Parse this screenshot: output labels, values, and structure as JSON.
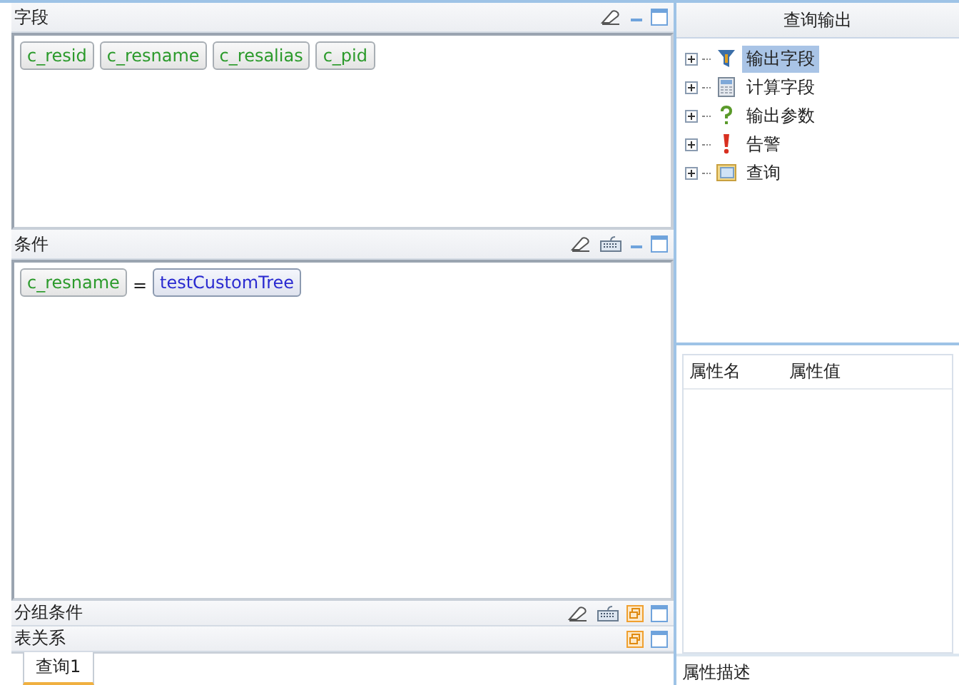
{
  "panels": [
    {
      "title": "字段",
      "keyboard": false,
      "collapsed": false,
      "kind": "fields",
      "chips": [
        "c_resid",
        "c_resname",
        "c_resalias",
        "c_pid"
      ]
    },
    {
      "title": "条件",
      "keyboard": true,
      "collapsed": false,
      "kind": "conditions",
      "conditions": [
        {
          "field": "c_resname",
          "operator": "=",
          "value": "testCustomTree"
        }
      ]
    },
    {
      "title": "分组条件",
      "keyboard": true,
      "collapsed": true
    },
    {
      "title": "表关系",
      "keyboard": false,
      "collapsed": true
    }
  ],
  "tabs": [
    {
      "label": "查询1",
      "selected": true
    }
  ],
  "output": {
    "title": "查询输出",
    "tree": [
      {
        "label": "输出字段",
        "kind": "filter",
        "selected": true,
        "expanded": false
      },
      {
        "label": "计算字段",
        "kind": "calc",
        "selected": false,
        "expanded": false
      },
      {
        "label": "输出参数",
        "kind": "question",
        "selected": false,
        "expanded": false
      },
      {
        "label": "告警",
        "kind": "alert",
        "selected": false,
        "expanded": false
      },
      {
        "label": "查询",
        "kind": "window",
        "selected": false,
        "expanded": false
      }
    ]
  },
  "properties": {
    "columns": [
      "属性名",
      "属性值"
    ],
    "description_label": "属性描述"
  }
}
